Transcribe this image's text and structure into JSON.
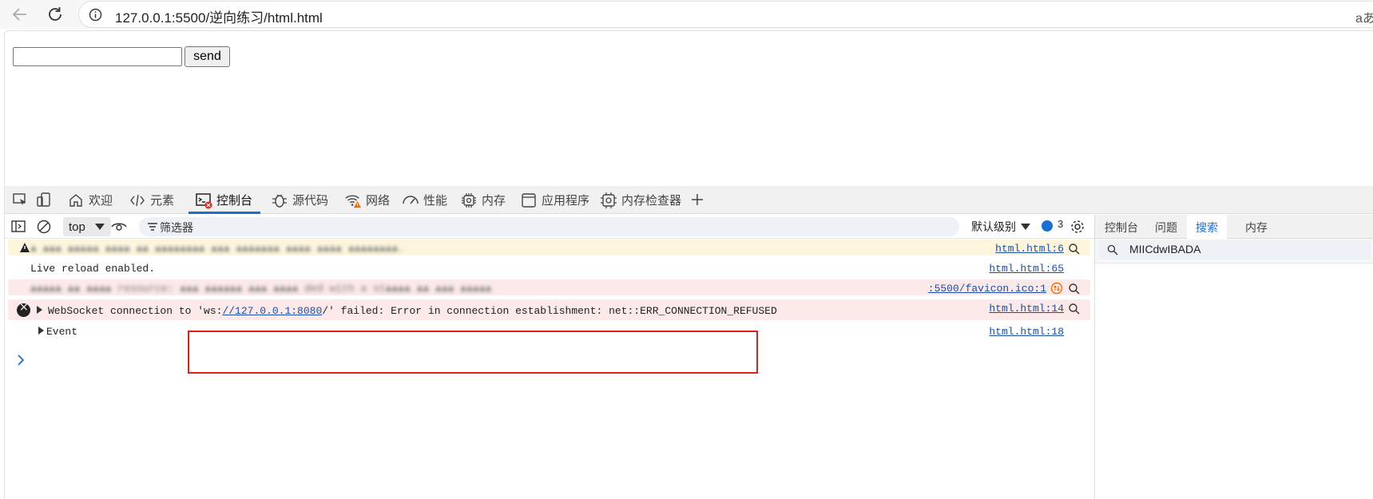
{
  "browser": {
    "url": "127.0.0.1:5500/逆向练习/html.html",
    "reader_label": "aあ"
  },
  "page": {
    "input_value": "",
    "send_label": "send"
  },
  "devtools": {
    "tabs": [
      {
        "label": "欢迎",
        "icon": "home-icon"
      },
      {
        "label": "元素",
        "icon": "code-icon"
      },
      {
        "label": "控制台",
        "icon": "console-icon",
        "active": true
      },
      {
        "label": "源代码",
        "icon": "bug-icon"
      },
      {
        "label": "网络",
        "icon": "wifi-icon"
      },
      {
        "label": "性能",
        "icon": "gauge-icon"
      },
      {
        "label": "内存",
        "icon": "chip-icon"
      },
      {
        "label": "应用程序",
        "icon": "window-icon"
      },
      {
        "label": "内存检查器",
        "icon": "memory-inspector-icon"
      }
    ],
    "toolbar": {
      "context": "top",
      "filter_placeholder": "筛选器",
      "level": "默认级别",
      "message_count": "3"
    },
    "console": {
      "rows": [
        {
          "type": "warning",
          "text": "▲ ▲▲▲ ▲▲▲▲▲ ▲▲▲▲ ▲▲ ▲▲▲▲▲▲▲▲ ▲▲▲ ▲▲▲▲▲▲▲ ▲▲▲▲ ▲▲▲▲ ▲▲▲▲▲▲▲▲.",
          "source": "html.html:6"
        },
        {
          "type": "info",
          "text": "Live reload enabled.",
          "source": "html.html:65"
        },
        {
          "type": "error",
          "text": "▲▲▲▲▲ ▲▲ ▲▲▲▲ resource: ▲▲▲ ▲▲▲▲▲▲ ▲▲▲ ▲▲▲▲ ded with a st▲▲▲▲ ▲▲ ▲▲▲ ▲▲▲▲▲",
          "source": ":5500/favicon.ico:1"
        },
        {
          "type": "error",
          "prefix": "WebSocket connection to 'ws:",
          "link": "//127.0.0.1:8080",
          "suffix": "/' failed: Error in connection establishment: net::ERR_CONNECTION_REFUSED",
          "source": "html.html:14"
        },
        {
          "type": "object",
          "text": "Event",
          "source": "html.html:18"
        }
      ]
    },
    "side_panel": {
      "tabs": [
        "控制台",
        "问题",
        "搜索",
        "内存"
      ],
      "active_tab": "搜索",
      "search_value": "MIICdwIBADA"
    }
  }
}
